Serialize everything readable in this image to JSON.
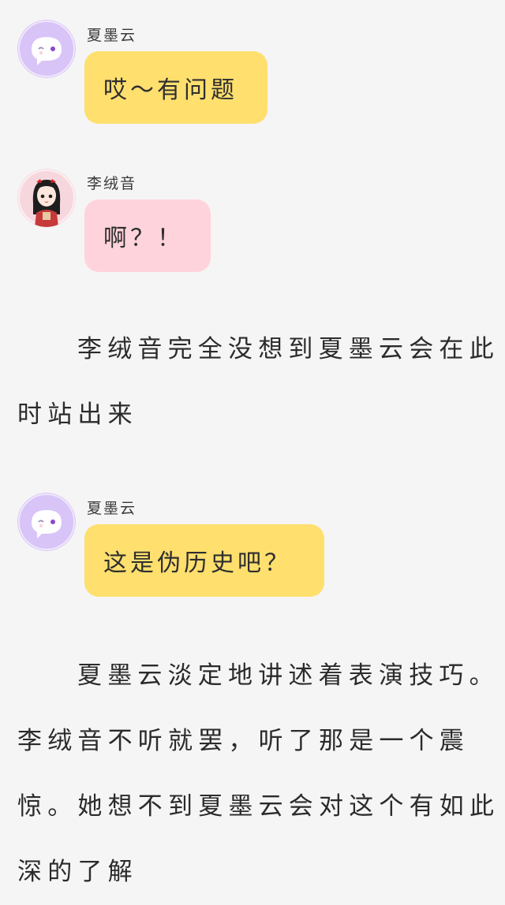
{
  "messages": [
    {
      "name": "夏墨云",
      "text": "哎～有问题",
      "avatar": "ghost-chat-icon",
      "color": "#ffdf6e"
    },
    {
      "name": "李绒音",
      "text": "啊？！",
      "avatar": "girl-avatar",
      "color": "#ffd3dc"
    },
    {
      "name": "夏墨云",
      "text": "这是伪历史吧？",
      "avatar": "ghost-chat-icon",
      "color": "#ffdf6e"
    }
  ],
  "narration": [
    "李绒音完全没想到夏墨云会在此时站出来",
    "夏墨云淡定地讲述着表演技巧。李绒音不听就罢，听了那是一个震惊。她想不到夏墨云会对这个有如此深的了解"
  ]
}
